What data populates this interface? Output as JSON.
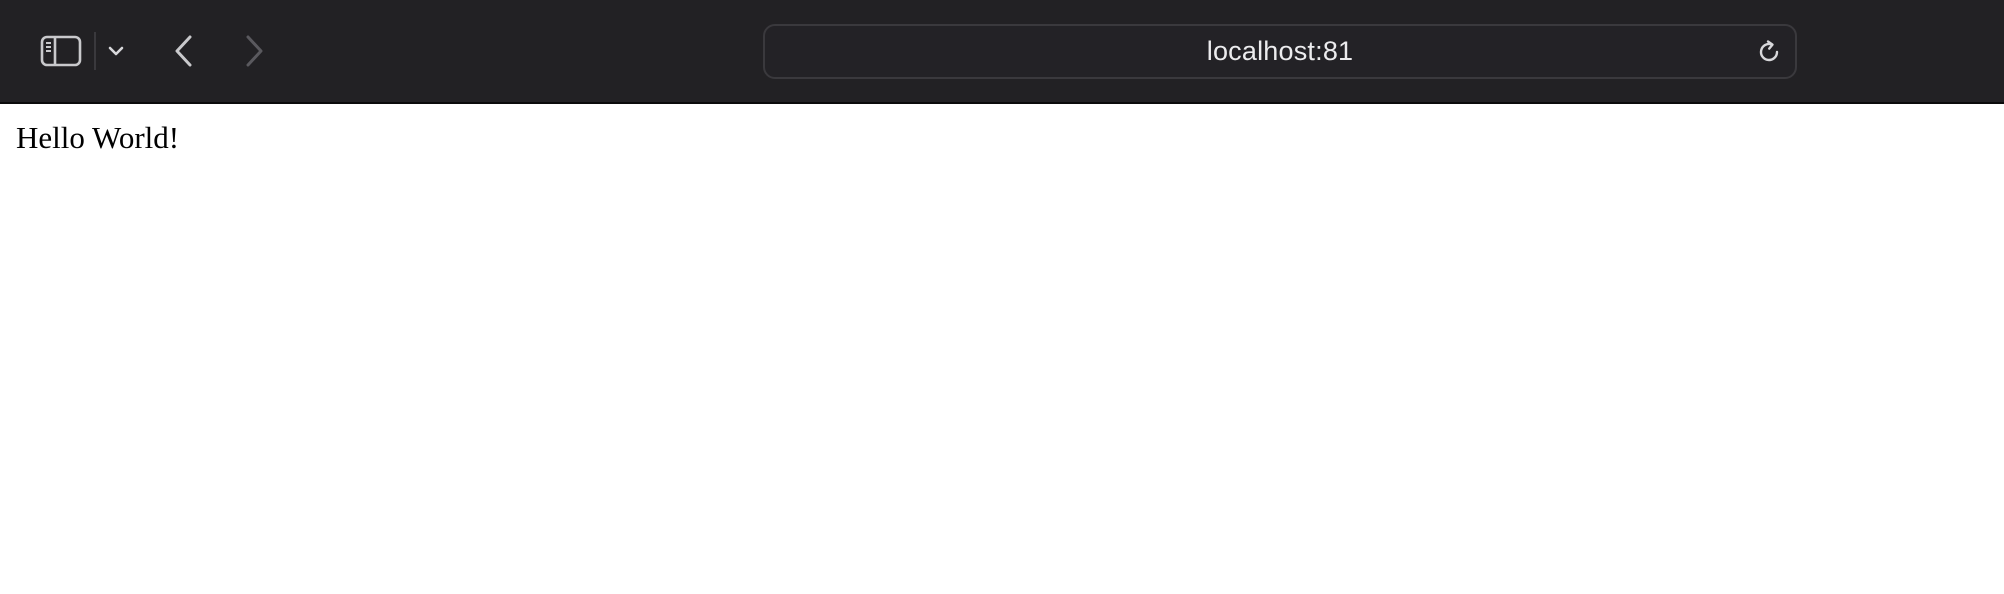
{
  "browser": {
    "address": "localhost:81",
    "icons": {
      "sidebar": "sidebar-icon",
      "chevron": "chevron-down-icon",
      "back": "back-arrow-icon",
      "forward": "forward-arrow-icon",
      "reload": "reload-icon"
    },
    "colors": {
      "toolbar_bg": "#222124",
      "icon": "#c9c9cc",
      "icon_disabled": "#5a595e",
      "address_text": "#ececee"
    }
  },
  "page": {
    "text": "Hello World!"
  }
}
